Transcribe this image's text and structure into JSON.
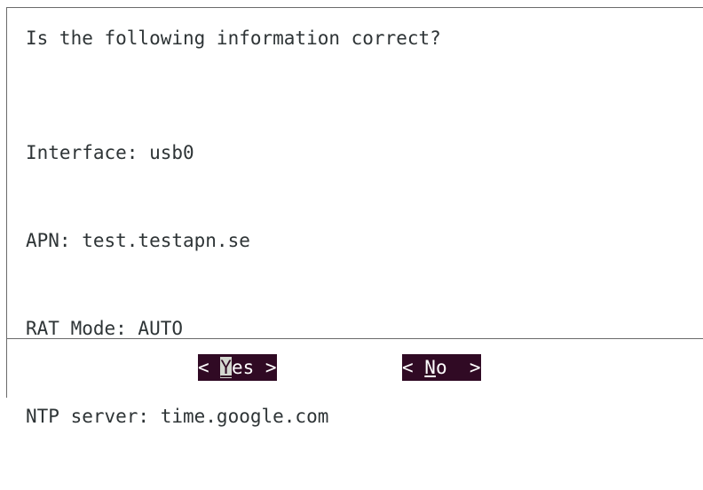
{
  "dialog": {
    "question": "Is the following information correct?",
    "info_lines": [
      "Interface: usb0",
      "APN: test.testapn.se",
      "RAT Mode: AUTO",
      "NTP server: time.google.com"
    ]
  },
  "buttons": {
    "yes": {
      "left": "< ",
      "hotkey": "Y",
      "rest": "es",
      "right": " >"
    },
    "no": {
      "left": "< ",
      "hotkey": "N",
      "rest": "o",
      "right": "  >"
    }
  },
  "colors": {
    "button_bg": "#300a24",
    "button_fg": "#ffffff",
    "text": "#2e3436",
    "border": "#6b6b6b"
  }
}
